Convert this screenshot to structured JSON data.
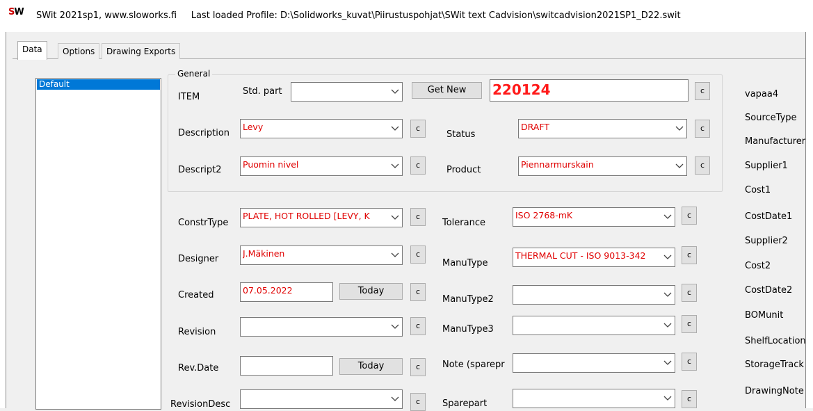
{
  "window": {
    "logo": "SW",
    "title": "SWit 2021sp1, www.sloworks.fi",
    "profile_text": "Last loaded Profile: D:\\Solidworks_kuvat\\Piirustuspohjat\\SWit text Cadvision\\switcadvision2021SP1_D22.swit"
  },
  "tabs": [
    "Data",
    "Options",
    "Drawing Exports"
  ],
  "profiles": [
    "Default"
  ],
  "general": {
    "group_label": "General",
    "item_label": "ITEM",
    "std_part_label": "Std. part",
    "std_part_value": "",
    "get_new_label": "Get New",
    "item_value": "220124",
    "description_label": "Description",
    "description_value": "Levy",
    "descript2_label": "Descript2",
    "descript2_value": "Puomin nivel",
    "status_label": "Status",
    "status_value": "DRAFT",
    "product_label": "Product",
    "product_value": "Piennarmurskain"
  },
  "fields": {
    "constrtype_label": "ConstrType",
    "constrtype_value": "PLATE, HOT ROLLED [LEVY, K",
    "designer_label": "Designer",
    "designer_value": "J.Mäkinen",
    "created_label": "Created",
    "created_value": "07.05.2022",
    "revision_label": "Revision",
    "revision_value": "",
    "revdate_label": "Rev.Date",
    "revdate_value": "",
    "revisiondesc_label": "RevisionDesc",
    "revisiondesc_value": "",
    "today_label": "Today",
    "tolerance_label": "Tolerance",
    "tolerance_value": "ISO 2768-mK",
    "manutype_label": "ManuType",
    "manutype_value": "THERMAL CUT - ISO 9013-342",
    "manutype2_label": "ManuType2",
    "manutype2_value": "",
    "manutype3_label": "ManuType3",
    "manutype3_value": "",
    "note_label": "Note (sparepr",
    "note_value": "",
    "sparepart_label": "Sparepart",
    "sparepart_value": ""
  },
  "c_label": "c",
  "right_labels": [
    "vapaa4",
    "SourceType",
    "Manufacturer",
    "Supplier1",
    "Cost1",
    "CostDate1",
    "Supplier2",
    "Cost2",
    "CostDate2",
    "BOMunit",
    "ShelfLocation",
    "StorageTrack",
    "DrawingNote"
  ],
  "colors": {
    "value_text": "#e00000",
    "selection": "#0078d7"
  }
}
